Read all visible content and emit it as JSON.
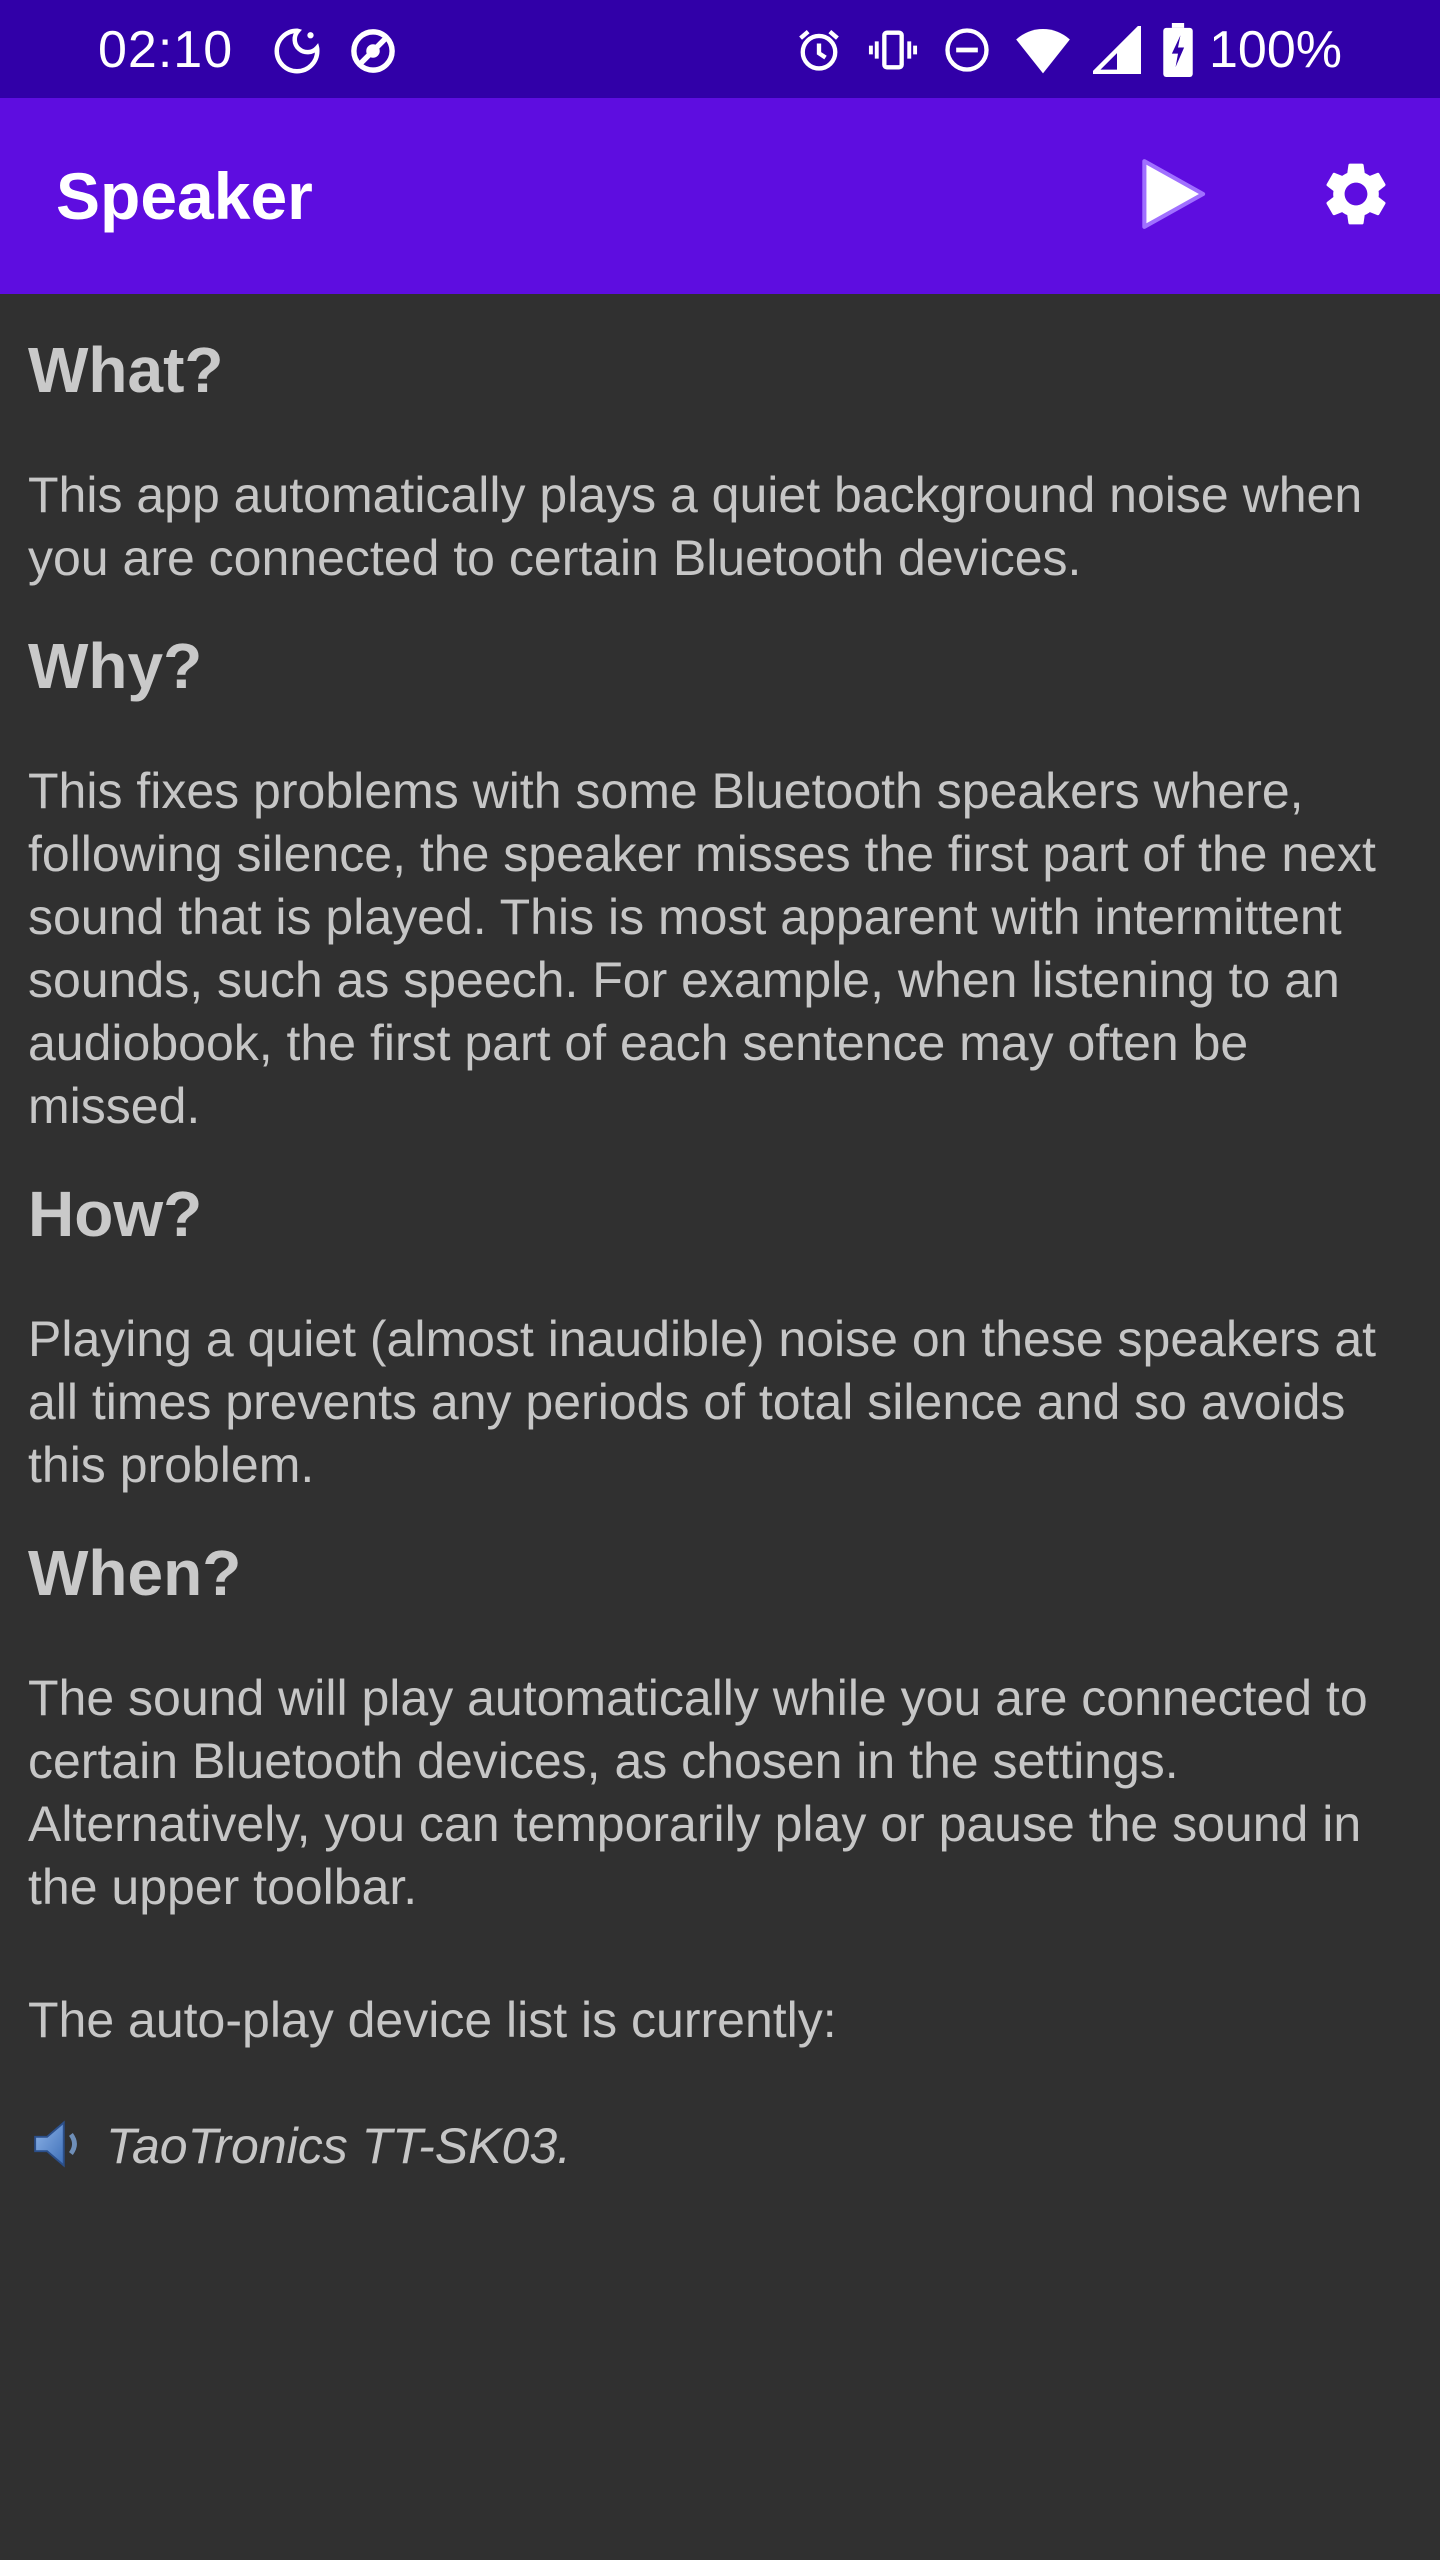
{
  "status_bar": {
    "time": "02:10",
    "left_icons": [
      "do-not-disturb-moon-icon",
      "data-saver-icon"
    ],
    "right_icons": [
      "alarm-icon",
      "vibrate-icon",
      "dnd-minus-icon",
      "wifi-icon",
      "cell-signal-icon",
      "battery-charging-icon"
    ],
    "battery": "100%"
  },
  "app_bar": {
    "title": "Speaker",
    "actions": [
      "play-icon",
      "settings-gear-icon"
    ],
    "background": "#5e0de0"
  },
  "sections": [
    {
      "heading": "What?",
      "body": "This app automatically plays a quiet background noise when you are connected to certain Bluetooth devices."
    },
    {
      "heading": "Why?",
      "body": "This fixes problems with some Bluetooth speakers where, following silence, the speaker misses the first part of the next sound that is played. This is most apparent with intermittent sounds, such as speech. For example, when listening to an audiobook, the first part of each sentence may often be missed."
    },
    {
      "heading": "How?",
      "body": "Playing a quiet (almost inaudible) noise on these speakers at all times prevents any periods of total silence and so avoids this problem."
    },
    {
      "heading": "When?",
      "body": "The sound will play automatically while you are connected to certain Bluetooth devices, as chosen in the settings. Alternatively, you can temporarily play or pause the sound in the upper toolbar."
    }
  ],
  "device_list": {
    "intro": "The auto-play device list is currently:",
    "icon": "speaker-icon",
    "devices": [
      "TaoTronics TT-SK03."
    ]
  },
  "colors": {
    "status_bar": "#3100a8",
    "app_bar": "#5e0de0",
    "background": "#303030",
    "text": "#c6c6c6"
  }
}
